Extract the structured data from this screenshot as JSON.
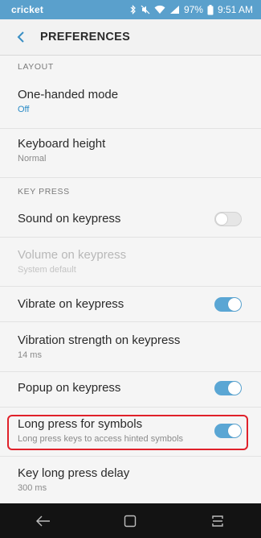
{
  "status_bar": {
    "carrier": "cricket",
    "battery": "97%",
    "time": "9:51 AM"
  },
  "header": {
    "title": "PREFERENCES"
  },
  "sections": {
    "layout": {
      "label": "LAYOUT",
      "one_handed": {
        "title": "One-handed mode",
        "value": "Off"
      },
      "keyboard_height": {
        "title": "Keyboard height",
        "value": "Normal"
      }
    },
    "key_press": {
      "label": "KEY PRESS",
      "sound": {
        "title": "Sound on keypress",
        "enabled": false
      },
      "volume": {
        "title": "Volume on keypress",
        "value": "System default",
        "disabled": true
      },
      "vibrate": {
        "title": "Vibrate on keypress",
        "enabled": true
      },
      "vibration_strength": {
        "title": "Vibration strength on keypress",
        "value": "14 ms"
      },
      "popup": {
        "title": "Popup on keypress",
        "enabled": true
      },
      "long_press_symbols": {
        "title": "Long press for symbols",
        "description": "Long press keys to access hinted symbols",
        "enabled": true
      },
      "long_press_delay": {
        "title": "Key long press delay",
        "value": "300 ms"
      }
    }
  },
  "colors": {
    "status_bar": "#5aa0cc",
    "accent": "#2a8bc6",
    "toggle_on": "#5aa6d4",
    "highlight": "#e0212a",
    "nav_bar": "#131313"
  }
}
